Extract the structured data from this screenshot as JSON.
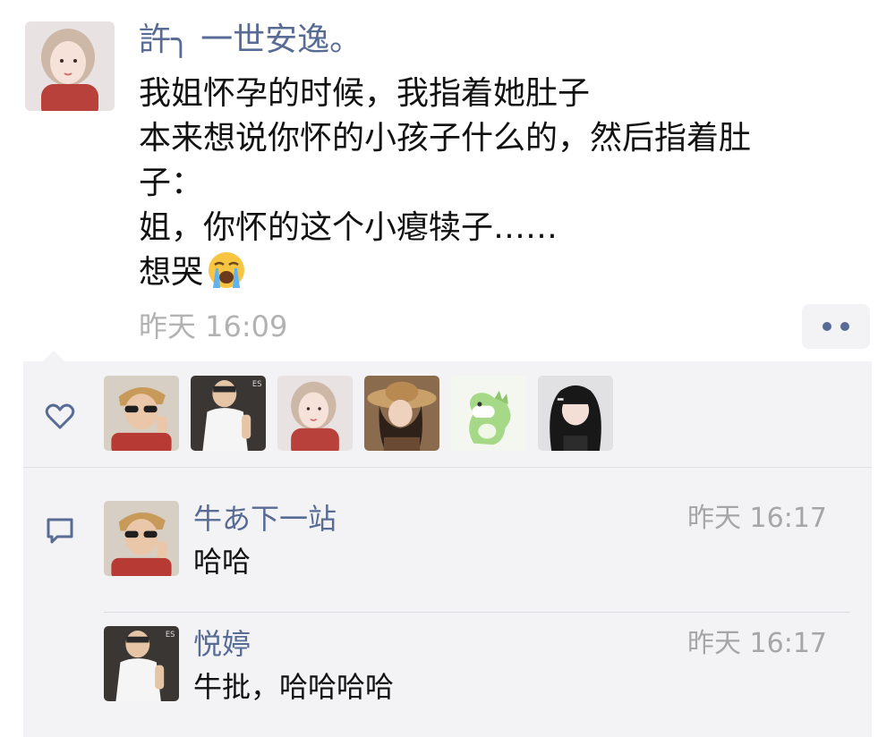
{
  "post": {
    "author": "許╮ 一世安逸。",
    "text_lines": [
      "我姐怀孕的时候，我指着她肚子",
      "本来想说你怀的小孩子什么的，然后指着肚",
      "子：",
      "姐，你怀的这个小瘪犊子……",
      "想哭"
    ],
    "emoji": "loudly-crying-face",
    "timestamp": "昨天 16:09"
  },
  "likes": {
    "icon": "heart-outline-icon",
    "avatars": [
      "avatar-sunglasses-man",
      "avatar-white-shirt-man",
      "avatar-girl-red-dress",
      "avatar-girl-straw-hat",
      "avatar-green-dinosaur",
      "avatar-girl-black-hair"
    ]
  },
  "comments": [
    {
      "author": "牛あ下一站",
      "time": "昨天 16:17",
      "text": "哈哈",
      "avatar": "avatar-sunglasses-man"
    },
    {
      "author": "悦婷",
      "time": "昨天 16:17",
      "text": "牛批，哈哈哈哈",
      "avatar": "avatar-white-shirt-man"
    }
  ],
  "colors": {
    "link_blue": "#576b95",
    "panel_bg": "#f3f3f5",
    "timestamp_gray": "#b2b2b2"
  }
}
